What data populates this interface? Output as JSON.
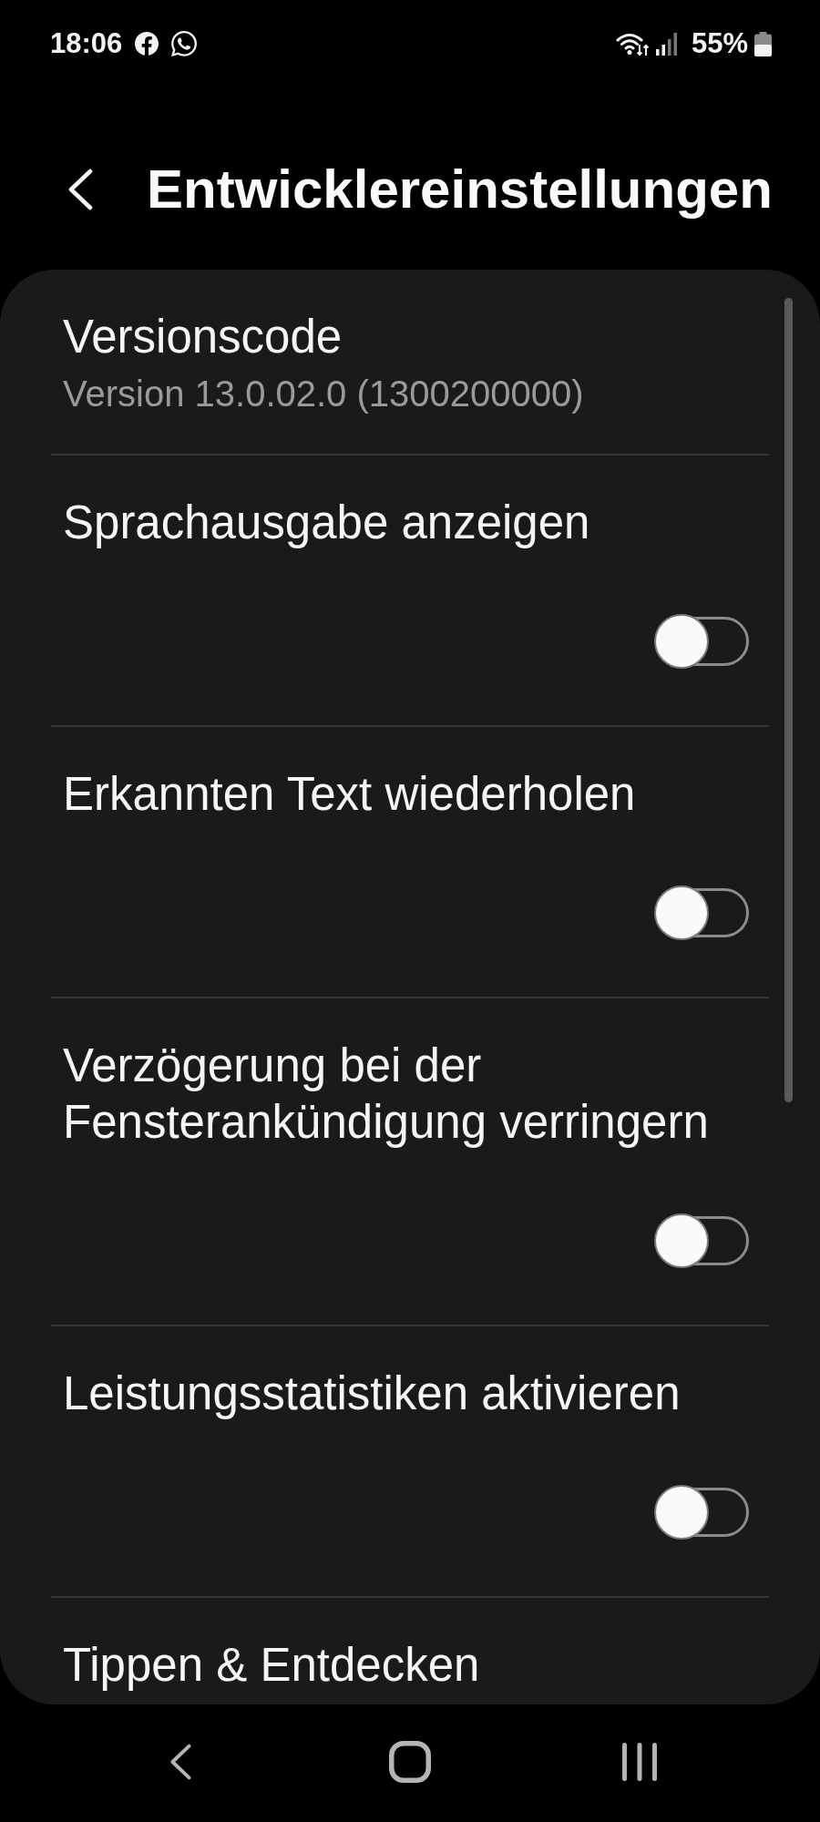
{
  "status_bar": {
    "time": "18:06",
    "battery": "55%"
  },
  "header": {
    "title": "Entwicklereinstellungen"
  },
  "settings": [
    {
      "kind": "text",
      "title": "Versionscode",
      "summary": "Version 13.0.02.0 (1300200000)"
    },
    {
      "kind": "toggle",
      "title": "Sprachausgabe anzeigen",
      "on": false
    },
    {
      "kind": "toggle",
      "title": "Erkannten Text wiederholen",
      "on": false
    },
    {
      "kind": "toggle",
      "title": "Verzögerung bei der Fensterankündigung verringern",
      "on": false
    },
    {
      "kind": "toggle",
      "title": "Leistungsstatistiken aktivieren",
      "on": false
    },
    {
      "kind": "text",
      "title": "Tippen & Entdecken"
    }
  ]
}
